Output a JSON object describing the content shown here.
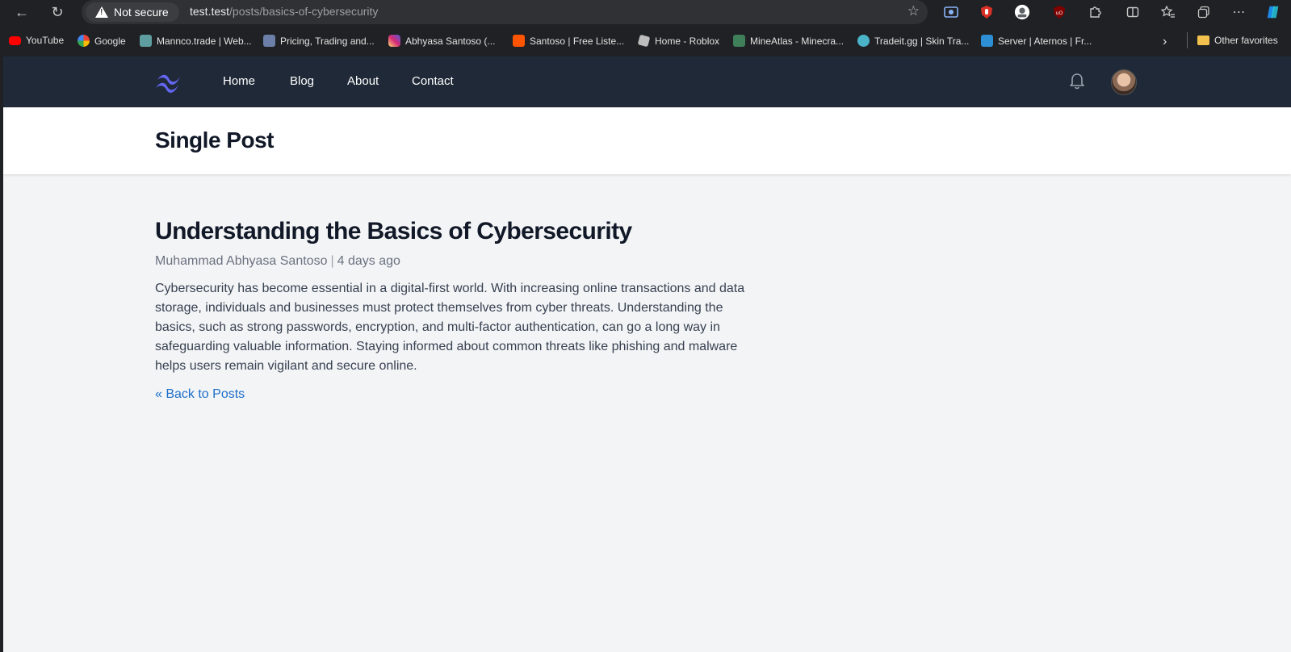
{
  "browser": {
    "security_label": "Not secure",
    "url_host": "test.test",
    "url_path": "/posts/basics-of-cybersecurity",
    "bookmarks": [
      {
        "label": "YouTube",
        "icon": "youtube-icon",
        "color": "#ff0000"
      },
      {
        "label": "Google",
        "icon": "google-icon",
        "color": "#4285f4"
      },
      {
        "label": "Mannco.trade | Web...",
        "icon": "mannco-icon",
        "color": "#5f9ea0"
      },
      {
        "label": "Pricing, Trading and...",
        "icon": "tf-icon",
        "color": "#6b7fa8"
      },
      {
        "label": "Abhyasa Santoso (...",
        "icon": "instagram-icon",
        "color": "#d62976"
      },
      {
        "label": "Santoso | Free Liste...",
        "icon": "soundcloud-icon",
        "color": "#ff5500"
      },
      {
        "label": "Home - Roblox",
        "icon": "roblox-icon",
        "color": "#bdbdbd"
      },
      {
        "label": "MineAtlas - Minecra...",
        "icon": "mineatlas-icon",
        "color": "#3f7f5a"
      },
      {
        "label": "Tradeit.gg | Skin Tra...",
        "icon": "tradeit-icon",
        "color": "#4ab3c8"
      },
      {
        "label": "Server | Aternos | Fr...",
        "icon": "aternos-icon",
        "color": "#2d8fd5"
      }
    ],
    "other_favorites": "Other favorites"
  },
  "site": {
    "nav": [
      {
        "label": "Home"
      },
      {
        "label": "Blog"
      },
      {
        "label": "About"
      },
      {
        "label": "Contact"
      }
    ],
    "accent": "#6366f1"
  },
  "header": {
    "title": "Single Post"
  },
  "post": {
    "title": "Understanding the Basics of Cybersecurity",
    "author": "Muhammad Abhyasa Santoso",
    "date": "4 days ago",
    "body_lines": [
      "Cybersecurity has become essential in a digital-first world. With increasing online transactions and data",
      "storage, individuals and businesses must protect themselves from cyber threats. Understanding the",
      "basics, such as strong passwords, encryption, and multi-factor authentication, can go a long way in",
      "safeguarding valuable information. Staying informed about common threats like phishing and malware",
      "helps users remain vigilant and secure online."
    ],
    "back_link": "« Back to Posts"
  }
}
